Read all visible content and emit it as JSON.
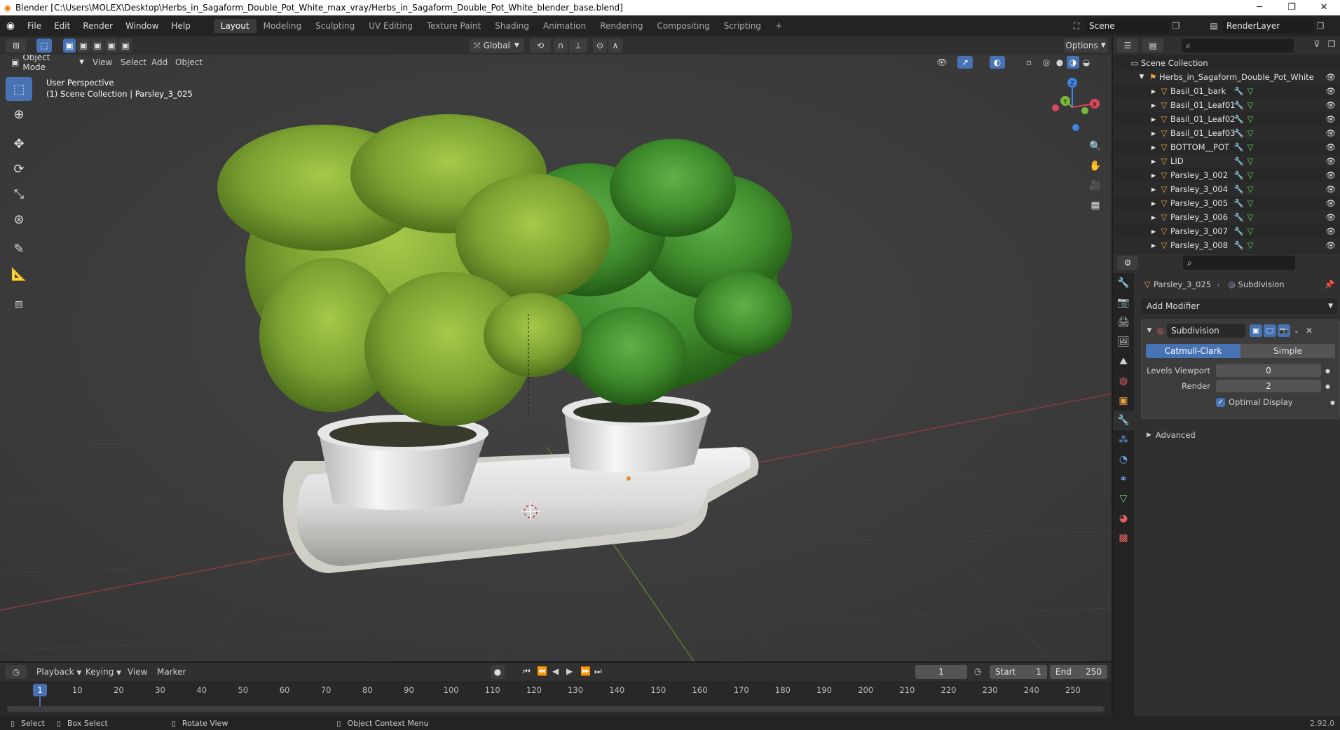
{
  "window": {
    "title": "Blender [C:\\Users\\MOLEX\\Desktop\\Herbs_in_Sagaform_Double_Pot_White_max_vray/Herbs_in_Sagaform_Double_Pot_White_blender_base.blend]"
  },
  "menu": [
    "File",
    "Edit",
    "Render",
    "Window",
    "Help"
  ],
  "workspaces": [
    "Layout",
    "Modeling",
    "Sculpting",
    "UV Editing",
    "Texture Paint",
    "Shading",
    "Animation",
    "Rendering",
    "Compositing",
    "Scripting"
  ],
  "workspace_add": "+",
  "scene": {
    "name": "Scene",
    "render_layer": "RenderLayer"
  },
  "tool_header": {
    "orientation": "Global",
    "options": "Options"
  },
  "viewport_header": {
    "mode": "Object Mode",
    "items": [
      "View",
      "Select",
      "Add",
      "Object"
    ]
  },
  "viewport": {
    "perspective": "User Perspective",
    "context": "(1) Scene Collection | Parsley_3_025"
  },
  "gizmo": {
    "x": "X",
    "y": "Y",
    "z": "Z"
  },
  "outliner": {
    "root": "Scene Collection",
    "collection": "Herbs_in_Sagaform_Double_Pot_White",
    "items": [
      "Basil_01_bark",
      "Basil_01_Leaf01",
      "Basil_01_Leaf02",
      "Basil_01_Leaf03",
      "BOTTOM__POT",
      "LID",
      "Parsley_3_002",
      "Parsley_3_004",
      "Parsley_3_005",
      "Parsley_3_006",
      "Parsley_3_007",
      "Parsley_3_008"
    ]
  },
  "properties": {
    "object": "Parsley_3_025",
    "modifier_context": "Subdivision",
    "add_modifier": "Add Modifier",
    "modifier": {
      "name": "Subdivision",
      "types": [
        "Catmull-Clark",
        "Simple"
      ],
      "levels_viewport_label": "Levels Viewport",
      "levels_viewport": "0",
      "render_label": "Render",
      "render": "2",
      "optimal_display": "Optimal Display",
      "advanced": "Advanced"
    }
  },
  "timeline": {
    "menus": [
      "Playback",
      "Keying",
      "View",
      "Marker"
    ],
    "current_frame": "1",
    "start_label": "Start",
    "start": "1",
    "end_label": "End",
    "end": "250",
    "ticks": [
      "10",
      "20",
      "30",
      "40",
      "50",
      "60",
      "70",
      "80",
      "90",
      "100",
      "110",
      "120",
      "130",
      "140",
      "150",
      "160",
      "170",
      "180",
      "190",
      "200",
      "210",
      "220",
      "230",
      "240",
      "250"
    ],
    "playhead": "1"
  },
  "statusbar": {
    "select": "Select",
    "box_select": "Box Select",
    "rotate_view": "Rotate View",
    "context_menu": "Object Context Menu",
    "version": "2.92.0"
  },
  "colors": {
    "accent": "#4772b3",
    "x_axis": "#d9475a",
    "y_axis": "#7cb83a",
    "z_axis": "#3d83e0",
    "mesh_icon": "#f0a33a"
  }
}
